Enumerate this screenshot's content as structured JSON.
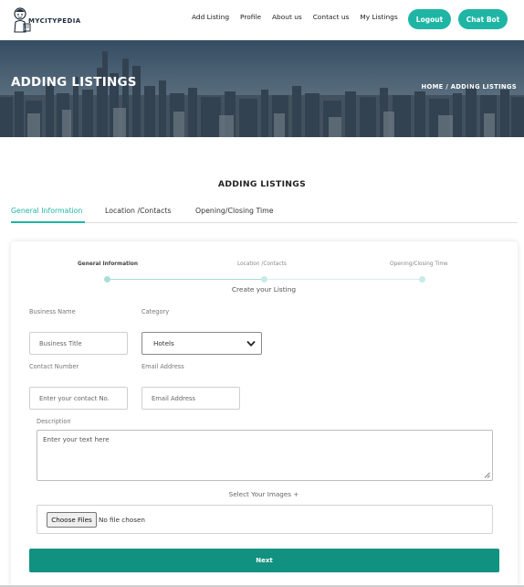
{
  "brand": {
    "name": "MYCITYPEDIA",
    "logo_icon": "city-guide-mascot-icon"
  },
  "nav": {
    "links": [
      "Add Listing",
      "Profile",
      "About us",
      "Contact us",
      "My Listings"
    ],
    "logout_label": "Logout",
    "chatbot_label": "Chat Bot",
    "accent": "#1fb5a4"
  },
  "hero": {
    "title": "ADDING LISTINGS",
    "breadcrumb": "HOME /  ADDING LISTINGS"
  },
  "section": {
    "title": "ADDING LISTINGS"
  },
  "tabs": [
    "General Information",
    "Location /Contacts",
    "Opening/Closing Time"
  ],
  "active_tab": 0,
  "stepper": {
    "steps": [
      "General Information",
      "Location /Contacts",
      "Opening/Closing Time"
    ],
    "caption": "Create your Listing"
  },
  "form": {
    "business_name_label": "Business Name",
    "business_name_placeholder": "Business Title",
    "category_label": "Category",
    "category_value": "Hotels",
    "contact_label": "Contact Number",
    "contact_placeholder": "Enter your contact No.",
    "email_label": "Email Address",
    "email_placeholder": "Email Address",
    "description_label": "Description",
    "description_placeholder": "Enter your text here",
    "images_label": "Select Your Images +",
    "choose_files_label": "Choose Files",
    "file_status": "No file chosen",
    "next_label": "Next",
    "button_color": "#11917f"
  }
}
